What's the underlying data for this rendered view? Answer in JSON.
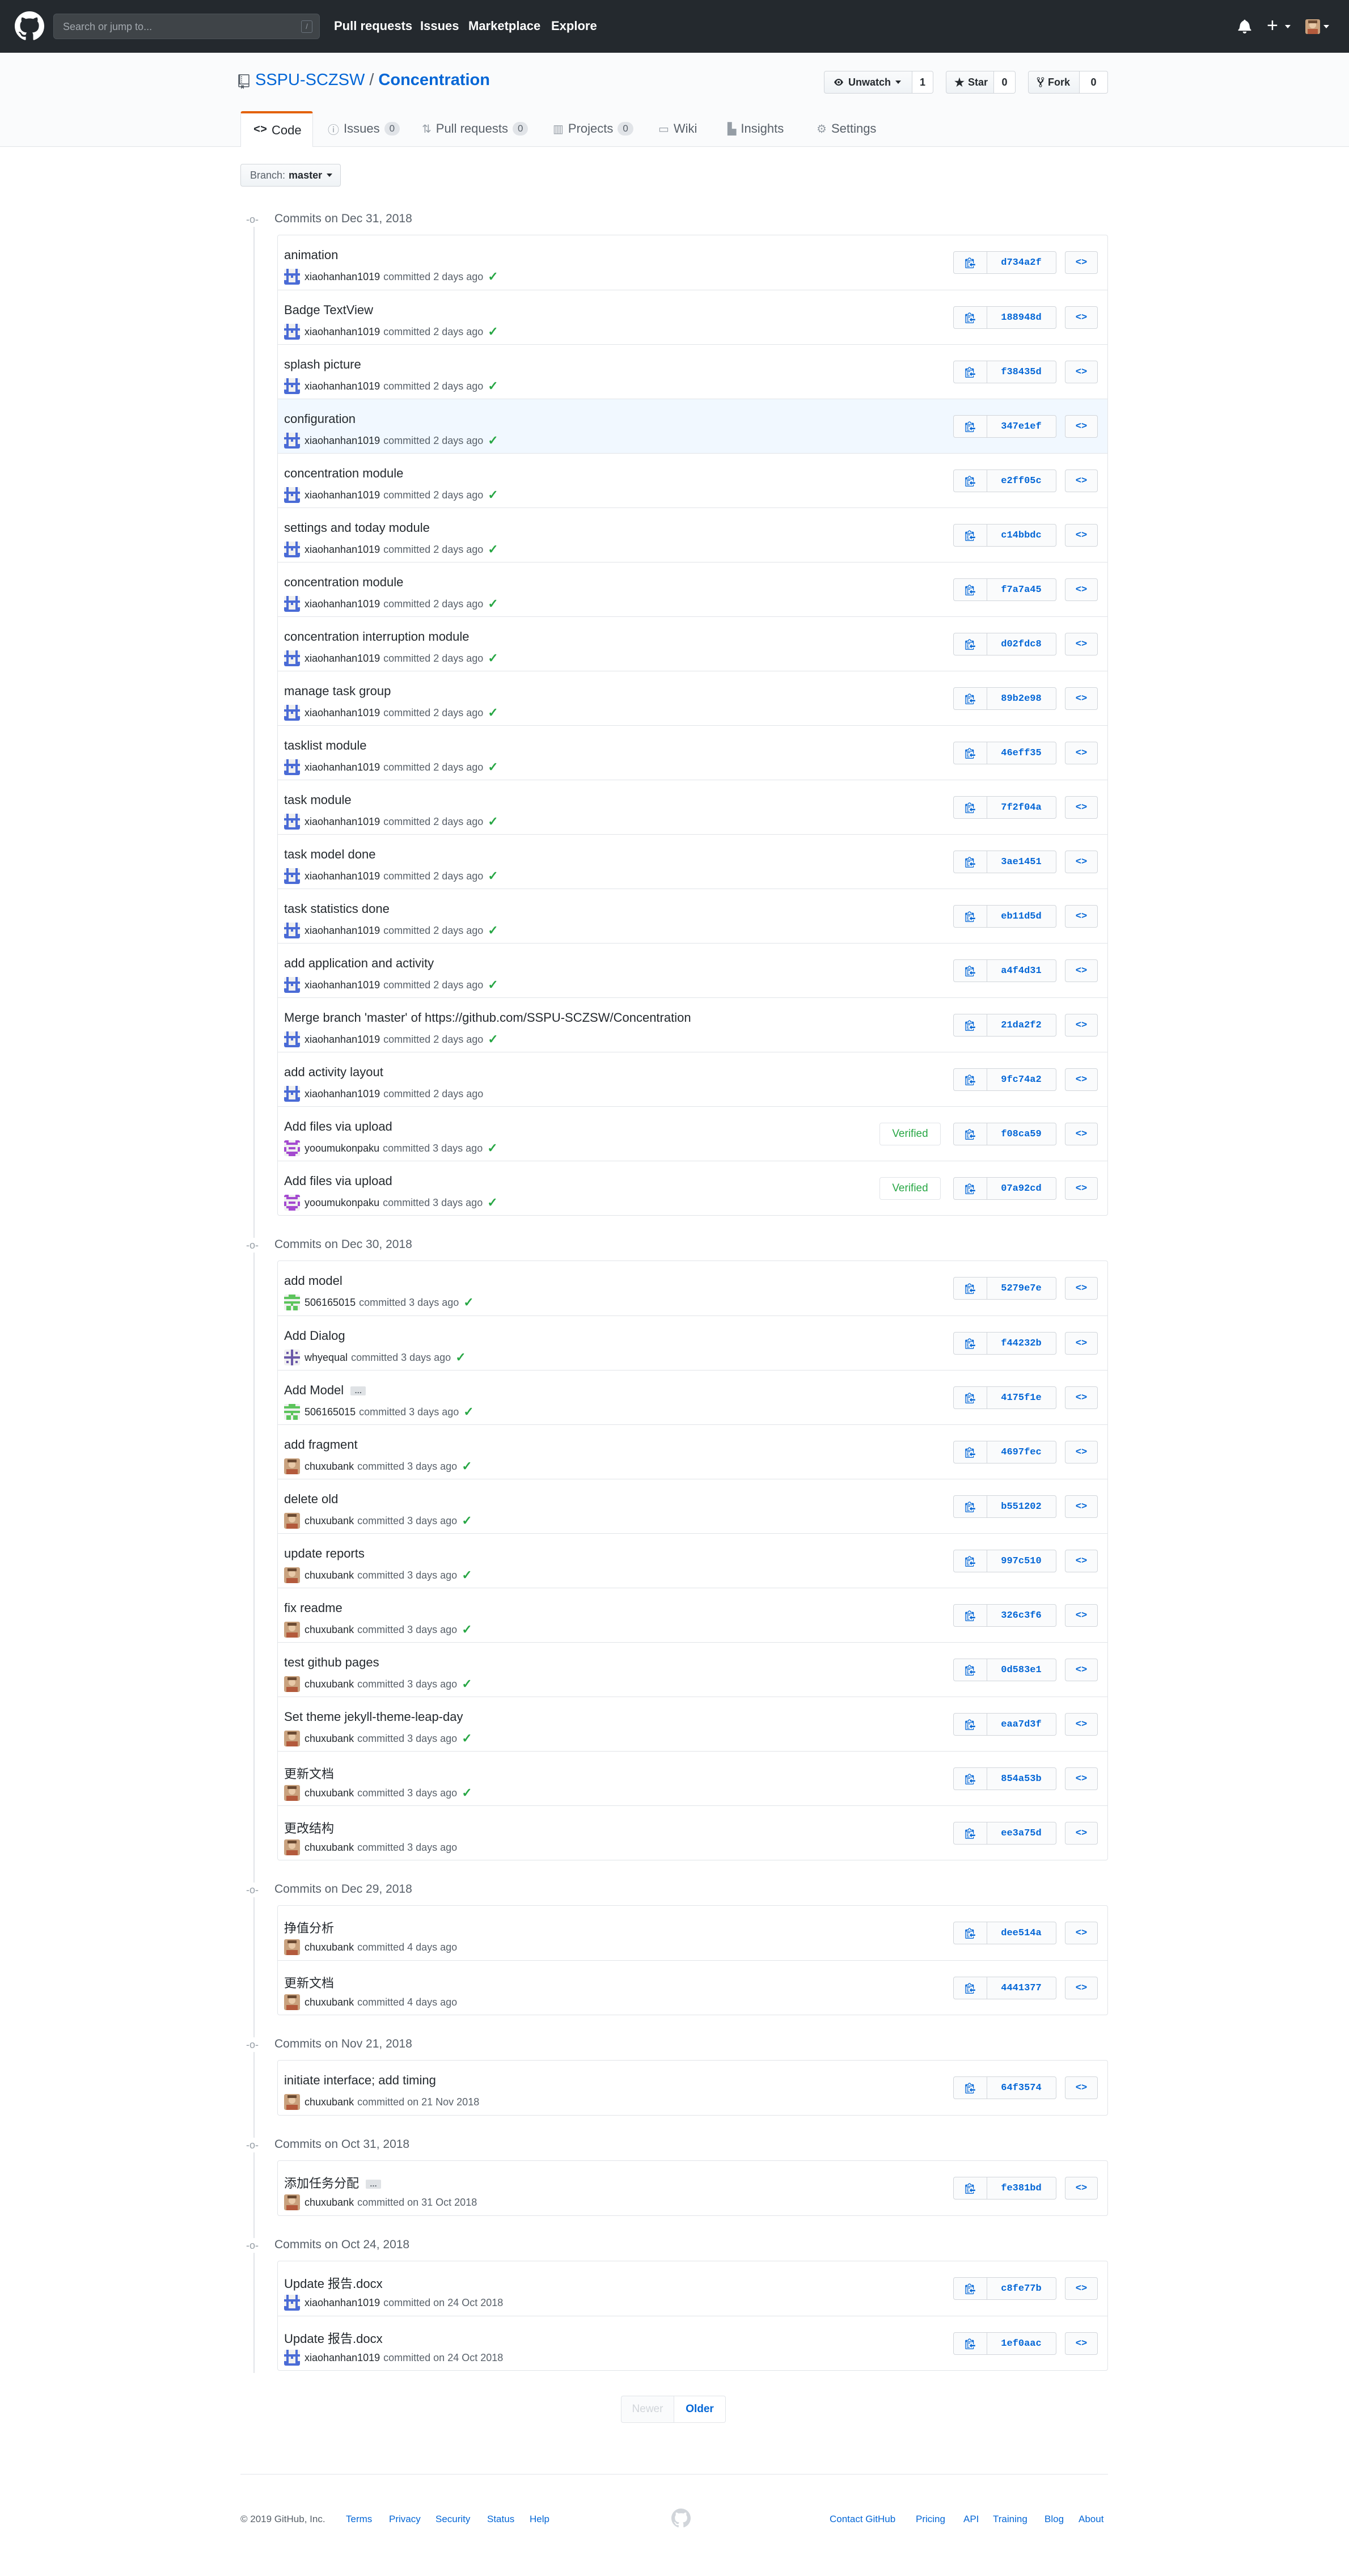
{
  "header": {
    "search_placeholder": "Search or jump to...",
    "search_key": "/",
    "nav": [
      "Pull requests",
      "Issues",
      "Marketplace",
      "Explore"
    ]
  },
  "repo": {
    "owner": "SSPU-SCZSW",
    "separator": "/",
    "name": "Concentration",
    "watch_label": "Unwatch",
    "watch_count": "1",
    "star_label": "Star",
    "star_count": "0",
    "fork_label": "Fork",
    "fork_count": "0",
    "tabs": {
      "code": "Code",
      "issues": "Issues",
      "issues_count": "0",
      "pulls": "Pull requests",
      "pulls_count": "0",
      "projects": "Projects",
      "projects_count": "0",
      "wiki": "Wiki",
      "insights": "Insights",
      "settings": "Settings"
    }
  },
  "branch": {
    "label": "Branch:",
    "value": "master"
  },
  "colors": {
    "accent": "#0366d6",
    "header_bg": "#24292e",
    "tab_active": "#e36209",
    "success": "#28a745"
  },
  "groups": [
    {
      "title": "Commits on Dec 31, 2018",
      "commits": [
        {
          "message": "animation",
          "author": "xiaohanhan1019",
          "verb": "committed",
          "when": "2 days ago",
          "check": "✓",
          "sha": "d734a2f",
          "avatar": "blue"
        },
        {
          "message": "Badge TextView",
          "author": "xiaohanhan1019",
          "verb": "committed",
          "when": "2 days ago",
          "check": "✓",
          "sha": "188948d",
          "avatar": "blue"
        },
        {
          "message": "splash picture",
          "author": "xiaohanhan1019",
          "verb": "committed",
          "when": "2 days ago",
          "check": "✓",
          "sha": "f38435d",
          "avatar": "blue"
        },
        {
          "message": "configuration",
          "author": "xiaohanhan1019",
          "verb": "committed",
          "when": "2 days ago",
          "check": "✓",
          "sha": "347e1ef",
          "avatar": "blue",
          "highlight": true
        },
        {
          "message": "concentration module",
          "author": "xiaohanhan1019",
          "verb": "committed",
          "when": "2 days ago",
          "check": "✓",
          "sha": "e2ff05c",
          "avatar": "blue"
        },
        {
          "message": "settings and today module",
          "author": "xiaohanhan1019",
          "verb": "committed",
          "when": "2 days ago",
          "check": "✓",
          "sha": "c14bbdc",
          "avatar": "blue"
        },
        {
          "message": "concentration module",
          "author": "xiaohanhan1019",
          "verb": "committed",
          "when": "2 days ago",
          "check": "✓",
          "sha": "f7a7a45",
          "avatar": "blue"
        },
        {
          "message": "concentration interruption module",
          "author": "xiaohanhan1019",
          "verb": "committed",
          "when": "2 days ago",
          "check": "✓",
          "sha": "d02fdc8",
          "avatar": "blue"
        },
        {
          "message": "manage task group",
          "author": "xiaohanhan1019",
          "verb": "committed",
          "when": "2 days ago",
          "check": "✓",
          "sha": "89b2e98",
          "avatar": "blue"
        },
        {
          "message": "tasklist module",
          "author": "xiaohanhan1019",
          "verb": "committed",
          "when": "2 days ago",
          "check": "✓",
          "sha": "46eff35",
          "avatar": "blue"
        },
        {
          "message": "task module",
          "author": "xiaohanhan1019",
          "verb": "committed",
          "when": "2 days ago",
          "check": "✓",
          "sha": "7f2f04a",
          "avatar": "blue"
        },
        {
          "message": "task model done",
          "author": "xiaohanhan1019",
          "verb": "committed",
          "when": "2 days ago",
          "check": "✓",
          "sha": "3ae1451",
          "avatar": "blue"
        },
        {
          "message": "task statistics done",
          "author": "xiaohanhan1019",
          "verb": "committed",
          "when": "2 days ago",
          "check": "✓",
          "sha": "eb11d5d",
          "avatar": "blue"
        },
        {
          "message": "add application and activity",
          "author": "xiaohanhan1019",
          "verb": "committed",
          "when": "2 days ago",
          "check": "✓",
          "sha": "a4f4d31",
          "avatar": "blue"
        },
        {
          "message": "Merge branch 'master' of https://github.com/SSPU-SCZSW/Concentration",
          "author": "xiaohanhan1019",
          "verb": "committed",
          "when": "2 days ago",
          "check": "✓",
          "sha": "21da2f2",
          "avatar": "blue"
        },
        {
          "message": "add activity layout",
          "author": "xiaohanhan1019",
          "verb": "committed",
          "when": "2 days ago",
          "check": "",
          "sha": "9fc74a2",
          "avatar": "blue"
        },
        {
          "message": "Add files via upload",
          "author": "yooumukonpaku",
          "verb": "committed",
          "when": "3 days ago",
          "check": "✓",
          "sha": "f08ca59",
          "avatar": "purple",
          "verified": "Verified"
        },
        {
          "message": "Add files via upload",
          "author": "yooumukonpaku",
          "verb": "committed",
          "when": "3 days ago",
          "check": "✓",
          "sha": "07a92cd",
          "avatar": "purple",
          "verified": "Verified"
        }
      ]
    },
    {
      "title": "Commits on Dec 30, 2018",
      "commits": [
        {
          "message": "add model",
          "author": "506165015",
          "verb": "committed",
          "when": "3 days ago",
          "check": "✓",
          "sha": "5279e7e",
          "avatar": "green"
        },
        {
          "message": "Add Dialog",
          "author": "whyequal",
          "verb": "committed",
          "when": "3 days ago",
          "check": "✓",
          "sha": "f44232b",
          "avatar": "indigo"
        },
        {
          "message": "Add Model",
          "author": "506165015",
          "verb": "committed",
          "when": "3 days ago",
          "check": "✓",
          "sha": "4175f1e",
          "avatar": "green",
          "ellipsis": "…"
        },
        {
          "message": "add fragment",
          "author": "chuxubank",
          "verb": "committed",
          "when": "3 days ago",
          "check": "✓",
          "sha": "4697fec",
          "avatar": "photo"
        },
        {
          "message": "delete old",
          "author": "chuxubank",
          "verb": "committed",
          "when": "3 days ago",
          "check": "✓",
          "sha": "b551202",
          "avatar": "photo"
        },
        {
          "message": "update reports",
          "author": "chuxubank",
          "verb": "committed",
          "when": "3 days ago",
          "check": "✓",
          "sha": "997c510",
          "avatar": "photo"
        },
        {
          "message": "fix readme",
          "author": "chuxubank",
          "verb": "committed",
          "when": "3 days ago",
          "check": "✓",
          "sha": "326c3f6",
          "avatar": "photo"
        },
        {
          "message": "test github pages",
          "author": "chuxubank",
          "verb": "committed",
          "when": "3 days ago",
          "check": "✓",
          "sha": "0d583e1",
          "avatar": "photo"
        },
        {
          "message": "Set theme jekyll-theme-leap-day",
          "author": "chuxubank",
          "verb": "committed",
          "when": "3 days ago",
          "check": "✓",
          "sha": "eaa7d3f",
          "avatar": "photo"
        },
        {
          "message": "更新文档",
          "author": "chuxubank",
          "verb": "committed",
          "when": "3 days ago",
          "check": "✓",
          "sha": "854a53b",
          "avatar": "photo"
        },
        {
          "message": "更改结构",
          "author": "chuxubank",
          "verb": "committed",
          "when": "3 days ago",
          "check": "",
          "sha": "ee3a75d",
          "avatar": "photo"
        }
      ]
    },
    {
      "title": "Commits on Dec 29, 2018",
      "commits": [
        {
          "message": "挣值分析",
          "author": "chuxubank",
          "verb": "committed",
          "when": "4 days ago",
          "check": "",
          "sha": "dee514a",
          "avatar": "photo"
        },
        {
          "message": "更新文档",
          "author": "chuxubank",
          "verb": "committed",
          "when": "4 days ago",
          "check": "",
          "sha": "4441377",
          "avatar": "photo"
        }
      ]
    },
    {
      "title": "Commits on Nov 21, 2018",
      "commits": [
        {
          "message": "initiate interface; add timing",
          "author": "chuxubank",
          "verb": "committed on",
          "when": "21 Nov 2018",
          "check": "",
          "sha": "64f3574",
          "avatar": "photo"
        }
      ]
    },
    {
      "title": "Commits on Oct 31, 2018",
      "commits": [
        {
          "message": "添加任务分配",
          "author": "chuxubank",
          "verb": "committed on",
          "when": "31 Oct 2018",
          "check": "",
          "sha": "fe381bd",
          "avatar": "photo",
          "ellipsis": "…"
        }
      ]
    },
    {
      "title": "Commits on Oct 24, 2018",
      "commits": [
        {
          "message": "Update 报告.docx",
          "author": "xiaohanhan1019",
          "verb": "committed on",
          "when": "24 Oct 2018",
          "check": "",
          "sha": "c8fe77b",
          "avatar": "blue"
        },
        {
          "message": "Update 报告.docx",
          "author": "xiaohanhan1019",
          "verb": "committed on",
          "when": "24 Oct 2018",
          "check": "",
          "sha": "1ef0aac",
          "avatar": "blue"
        }
      ]
    }
  ],
  "pagination": {
    "newer": "Newer",
    "older": "Older"
  },
  "footer": {
    "copyright": "© 2019 GitHub, Inc.",
    "left_links": [
      "Terms",
      "Privacy",
      "Security",
      "Status",
      "Help"
    ],
    "right_links": [
      "Contact GitHub",
      "Pricing",
      "API",
      "Training",
      "Blog",
      "About"
    ]
  }
}
